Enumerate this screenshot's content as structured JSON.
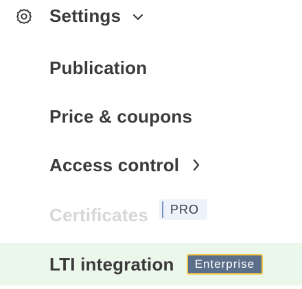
{
  "settings": {
    "label": "Settings",
    "icon": "gear-icon",
    "chevron_icon": "chevron-down-icon"
  },
  "items": [
    {
      "label": "Publication"
    },
    {
      "label": "Price & coupons"
    },
    {
      "label": "Access control",
      "chevron_icon": "chevron-right-icon"
    },
    {
      "label": "Certificates",
      "badge": "PRO",
      "disabled": true
    },
    {
      "label": "LTI integration",
      "badge": "Enterprise",
      "active": true
    }
  ],
  "colors": {
    "text": "#3a3a3a",
    "disabled_text": "#d7d7d7",
    "active_bg": "#ecf7ec",
    "pro_badge_bg": "#eef2fb",
    "enterprise_badge_bg": "#5c6f8a",
    "enterprise_badge_border": "#f2c84b"
  }
}
